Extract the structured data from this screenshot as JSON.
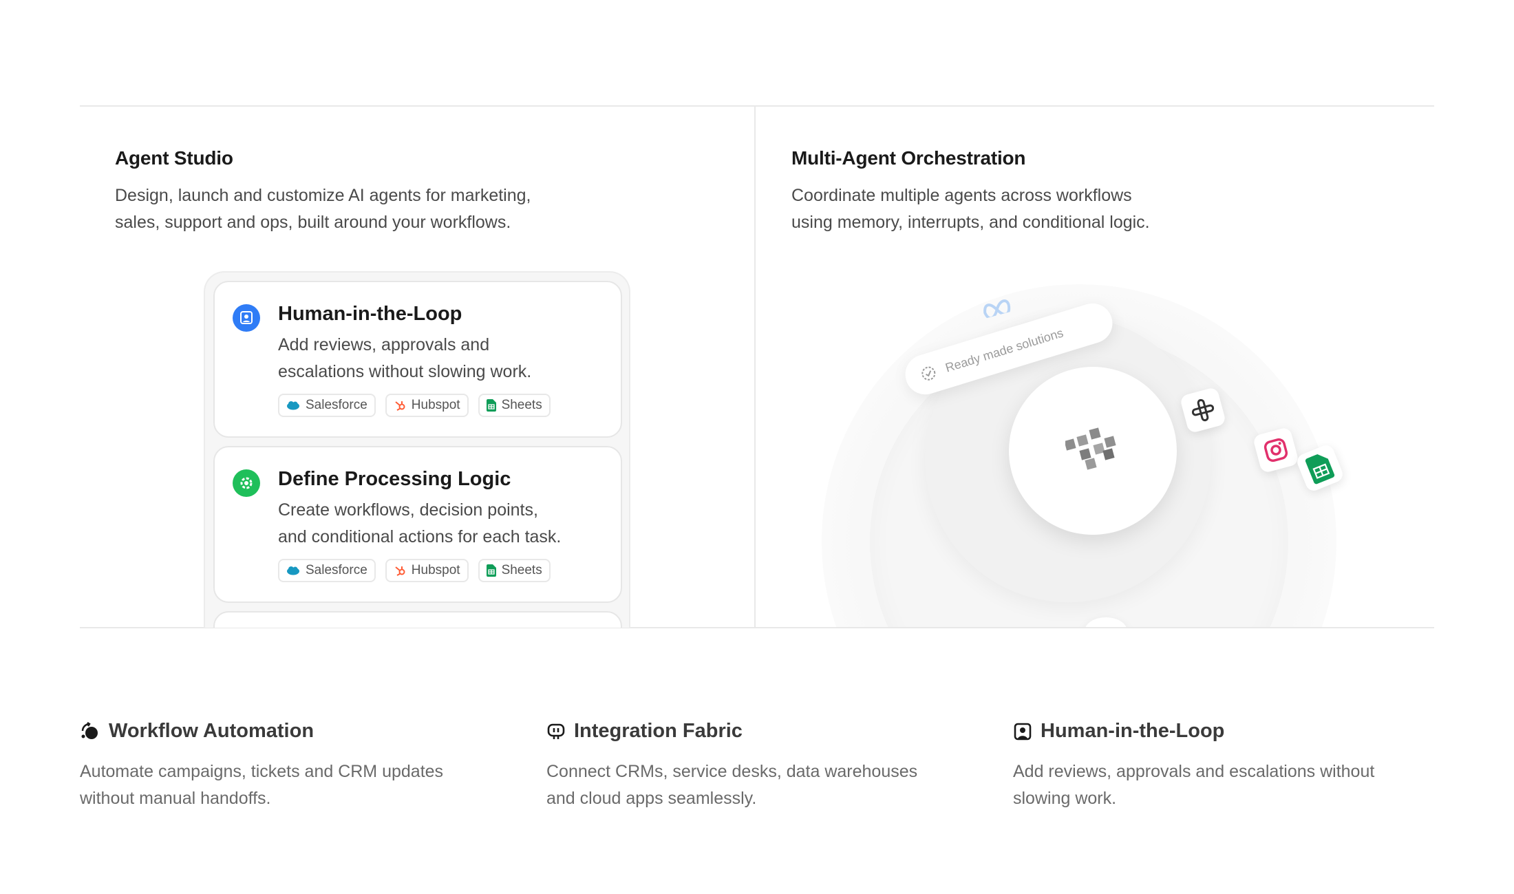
{
  "agent_studio": {
    "title": "Agent Studio",
    "description_line1": "Design, launch and customize AI agents for marketing,",
    "description_line2": "sales, support and ops, built around your workflows."
  },
  "cards": [
    {
      "title": "Human-in-the-Loop",
      "description_line1": "Add reviews, approvals and",
      "description_line2": "escalations without slowing work.",
      "icon": "human-loop-icon",
      "icon_color": "#2f7cf6",
      "chips": [
        "Salesforce",
        "Hubspot",
        "Sheets"
      ]
    },
    {
      "title": "Define Processing Logic",
      "description_line1": "Create workflows, decision points,",
      "description_line2": "and conditional actions for each task.",
      "icon": "gear-icon",
      "icon_color": "#1fbf5a",
      "chips": [
        "Salesforce",
        "Hubspot",
        "Sheets"
      ]
    }
  ],
  "orchestration": {
    "title": "Multi-Agent Orchestration",
    "description_line1": "Coordinate multiple agents across workflows",
    "description_line2": "using memory, interrupts, and conditional logic.",
    "pill_label": "Ready made solutions",
    "integration_icons": [
      "meta-icon",
      "slack-icon",
      "instagram-icon",
      "sheets-icon"
    ]
  },
  "features": [
    {
      "title": "Workflow Automation",
      "description_line1": "Automate campaigns, tickets and CRM updates",
      "description_line2": "without manual handoffs.",
      "icon": "workflow-icon"
    },
    {
      "title": "Integration Fabric",
      "description_line1": "Connect CRMs, service desks, data warehouses",
      "description_line2": "and cloud apps seamlessly.",
      "icon": "integration-icon"
    },
    {
      "title": "Human-in-the-Loop",
      "description_line1": "Add reviews, approvals and escalations without",
      "description_line2": "slowing work.",
      "icon": "human-loop-icon"
    }
  ],
  "colors": {
    "salesforce": "#1798c1",
    "hubspot": "#ff5c35",
    "sheets": "#0f9d58",
    "instagram": "#e1306c"
  }
}
